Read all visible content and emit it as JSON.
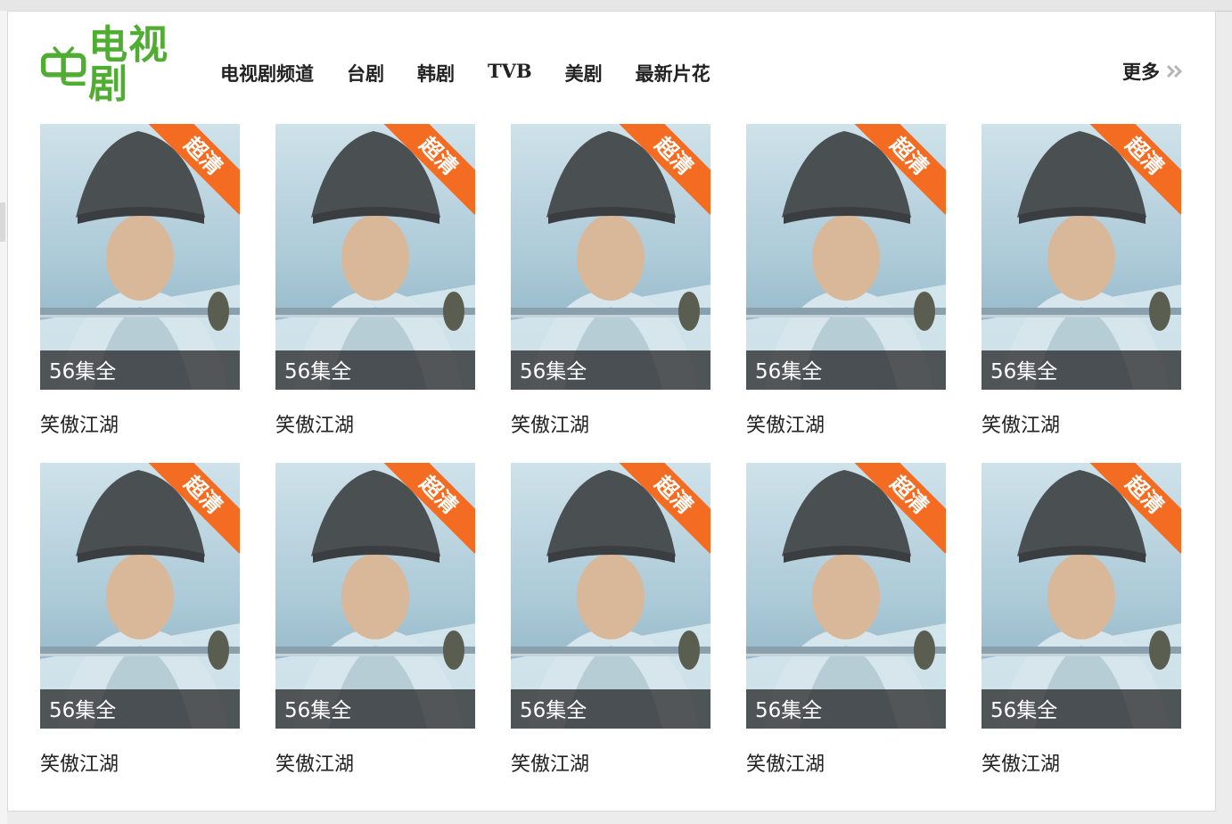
{
  "header": {
    "logo_text": "电视剧",
    "nav": [
      {
        "label": "电视剧频道"
      },
      {
        "label": "台剧"
      },
      {
        "label": "韩剧"
      },
      {
        "label": "TVB"
      },
      {
        "label": "美剧"
      },
      {
        "label": "最新片花"
      }
    ],
    "more_label": "更多"
  },
  "colors": {
    "brand_green": "#4fae32",
    "badge_orange": "#f36c21"
  },
  "items": [
    {
      "title": "笑傲江湖",
      "badge": "超清",
      "episodes": "56集全"
    },
    {
      "title": "笑傲江湖",
      "badge": "超清",
      "episodes": "56集全"
    },
    {
      "title": "笑傲江湖",
      "badge": "超清",
      "episodes": "56集全"
    },
    {
      "title": "笑傲江湖",
      "badge": "超清",
      "episodes": "56集全"
    },
    {
      "title": "笑傲江湖",
      "badge": "超清",
      "episodes": "56集全"
    },
    {
      "title": "笑傲江湖",
      "badge": "超清",
      "episodes": "56集全"
    },
    {
      "title": "笑傲江湖",
      "badge": "超清",
      "episodes": "56集全"
    },
    {
      "title": "笑傲江湖",
      "badge": "超清",
      "episodes": "56集全"
    },
    {
      "title": "笑傲江湖",
      "badge": "超清",
      "episodes": "56集全"
    },
    {
      "title": "笑傲江湖",
      "badge": "超清",
      "episodes": "56集全"
    }
  ]
}
